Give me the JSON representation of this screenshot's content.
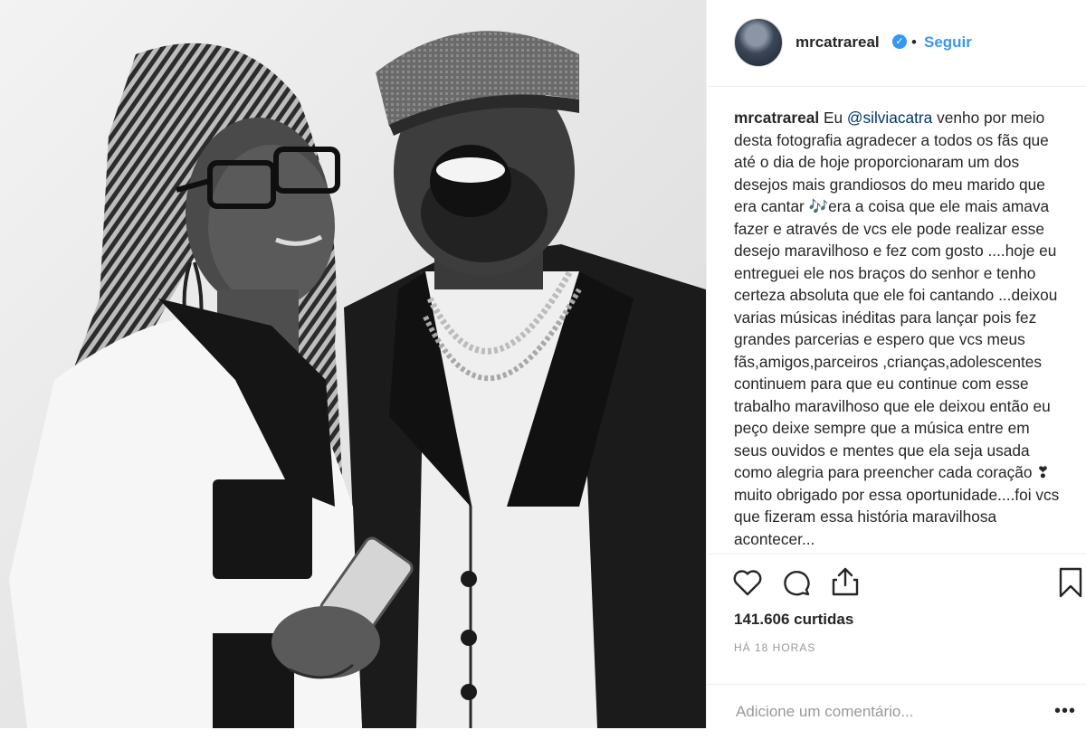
{
  "post": {
    "username": "mrcatrareal",
    "verified_icon": "✓",
    "separator": "•",
    "follow_label": "Seguir",
    "caption": {
      "username": "mrcatrareal",
      "prefix": "Eu ",
      "mention": "@silviacatra",
      "text": " venho por meio desta fotografia agradecer a todos os fãs que até o dia de hoje proporcionaram um dos desejos mais grandiosos do meu marido que era cantar 🎶era a coisa que ele mais amava fazer e através de vcs ele pode realizar esse desejo maravilhoso e fez com gosto ....hoje eu entreguei ele nos braços do senhor e tenho certeza absoluta que ele foi cantando ...deixou varias músicas inéditas para lançar pois fez grandes parcerias e espero que vcs meus fãs,amigos,parceiros ,crianças,adolescentes continuem para que eu continue com esse trabalho maravilhoso que ele deixou então eu peço deixe sempre que a música entre em seus ouvidos e mentes que ela seja usada como alegria para preencher cada coração ❣ muito obrigado por essa oportunidade....foi vcs que fizeram essa história maravilhosa acontecer..."
    },
    "likes": "141.606 curtidas",
    "time": "HÁ 18 HORAS",
    "comment_placeholder": "Adicione um comentário...",
    "more_icon": "•••"
  },
  "icons": {
    "like": "heart-icon",
    "comment": "comment-bubble-icon",
    "share": "share-icon",
    "save": "bookmark-icon"
  },
  "colors": {
    "link_blue": "#3897f0",
    "text": "#262626",
    "muted": "#999999",
    "border": "#efefef"
  }
}
